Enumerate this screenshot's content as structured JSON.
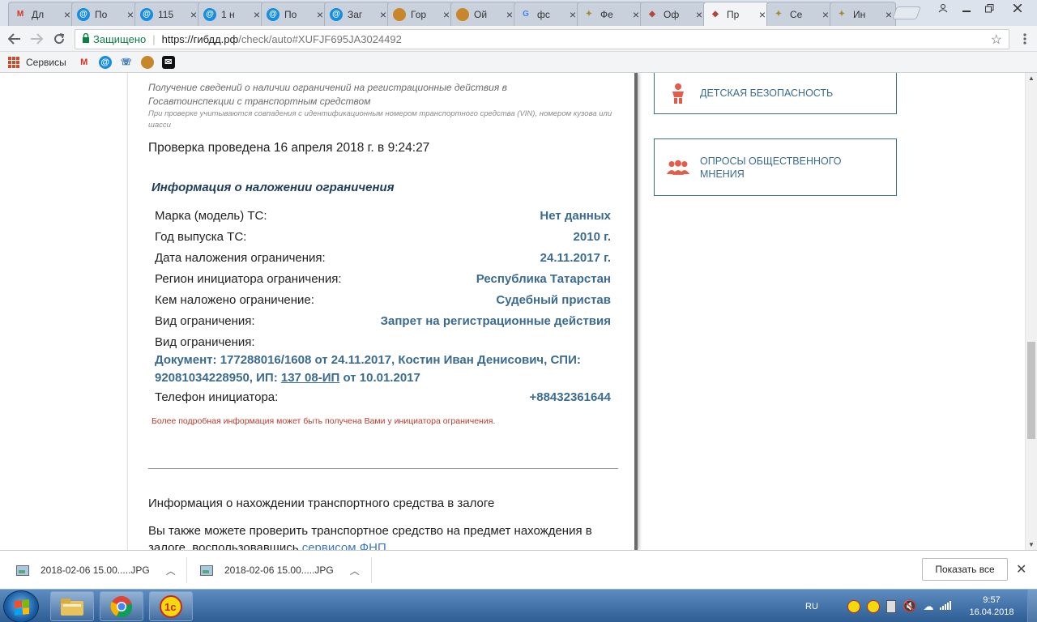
{
  "tabs": [
    {
      "label": "Дл",
      "icon": "gmail-icon",
      "color": "#d93025",
      "glyph": "M"
    },
    {
      "label": "По",
      "icon": "mail-ru-icon",
      "color": "#168de2",
      "glyph": "@"
    },
    {
      "label": "115",
      "icon": "mail-ru-icon",
      "color": "#168de2",
      "glyph": "@"
    },
    {
      "label": "1 н",
      "icon": "mail-ru-icon",
      "color": "#168de2",
      "glyph": "@"
    },
    {
      "label": "По",
      "icon": "mail-ru-icon",
      "color": "#168de2",
      "glyph": "@"
    },
    {
      "label": "Заг",
      "icon": "mail-ru-icon",
      "color": "#168de2",
      "glyph": "@"
    },
    {
      "label": "Гор",
      "icon": "bread-icon",
      "color": "#c8862a",
      "glyph": "●"
    },
    {
      "label": "Ой",
      "icon": "bread-icon",
      "color": "#c8862a",
      "glyph": "●"
    },
    {
      "label": "фс",
      "icon": "google-icon",
      "color": "#4285f4",
      "glyph": "G"
    },
    {
      "label": "Фе",
      "icon": "eagle-emblem-icon",
      "color": "#a58a2e",
      "glyph": "✦"
    },
    {
      "label": "Оф",
      "icon": "police-emblem-icon",
      "color": "#b5463a",
      "glyph": "◆"
    },
    {
      "label": "Пр",
      "icon": "police-emblem-icon",
      "color": "#b5463a",
      "glyph": "◆",
      "active": true
    },
    {
      "label": "Се",
      "icon": "eagle-emblem-icon",
      "color": "#a58a2e",
      "glyph": "✦"
    },
    {
      "label": "Ин",
      "icon": "eagle-emblem-icon",
      "color": "#a58a2e",
      "glyph": "✦"
    }
  ],
  "address": {
    "secure_label": "Защищено",
    "url_host": "https://гибдд.рф",
    "url_path": "/check/auto#XUFJF695JA3024492"
  },
  "bookmarks": {
    "services_label": "Сервисы"
  },
  "page": {
    "note_main": "Получение сведений о наличии ограничений на регистрационные действия в Госавтоинспекции с транспортным средством",
    "note_small": "При проверке учитываются совпадения с идентификационным номером транспортного средства (VIN), номером кузова или шасси",
    "checked": "Проверка проведена 16 апреля 2018 г. в 9:24:27",
    "info_title": "Информация о наложении ограничения",
    "rows": [
      {
        "label": "Марка (модель) ТС:",
        "value": "Нет данных"
      },
      {
        "label": "Год выпуска ТС:",
        "value": "2010 г."
      },
      {
        "label": "Дата наложения ограничения:",
        "value": "24.11.2017 г."
      },
      {
        "label": "Регион инициатора ограничения:",
        "value": "Республика Татарстан"
      },
      {
        "label": "Кем наложено ограничение:",
        "value": "Судебный пристав"
      },
      {
        "label": "Вид ограничения:",
        "value": "Запрет на регистрационные действия"
      },
      {
        "label": "Вид ограничения:",
        "value": ""
      }
    ],
    "document_text": "Документ: 177288016/1608 от 24.11.2017, Костин Иван Денисович, СПИ: 92081034228950, ИП: ",
    "document_link": "137           08-ИП",
    "document_tail": " от 10.01.2017",
    "phone_label": "Телефон инициатора:",
    "phone_value": "+88432361644",
    "warning": "Более подробная информация может быть получена Вами у инициатора ограничения.",
    "pledge_title": "Информация о нахождении транспортного средства в залоге",
    "pledge_text": "Вы также можете проверить транспортное средство на предмет нахождения в залоге, воспользовавшись ",
    "pledge_link": "сервисом ФНП"
  },
  "sidebar": {
    "child_safety": "ДЕТСКАЯ БЕЗОПАСНОСТЬ",
    "surveys": "ОПРОСЫ ОБЩЕСТВЕННОГО МНЕНИЯ"
  },
  "downloads": {
    "items": [
      "2018-02-06 15.00.....JPG",
      "2018-02-06 15.00.....JPG"
    ],
    "show_all": "Показать все"
  },
  "taskbar": {
    "lang": "RU",
    "time": "9:57",
    "date": "16.04.2018"
  },
  "colors": {
    "accent": "#3a6b92",
    "warning": "#c0392b",
    "secure": "#0b8043"
  }
}
